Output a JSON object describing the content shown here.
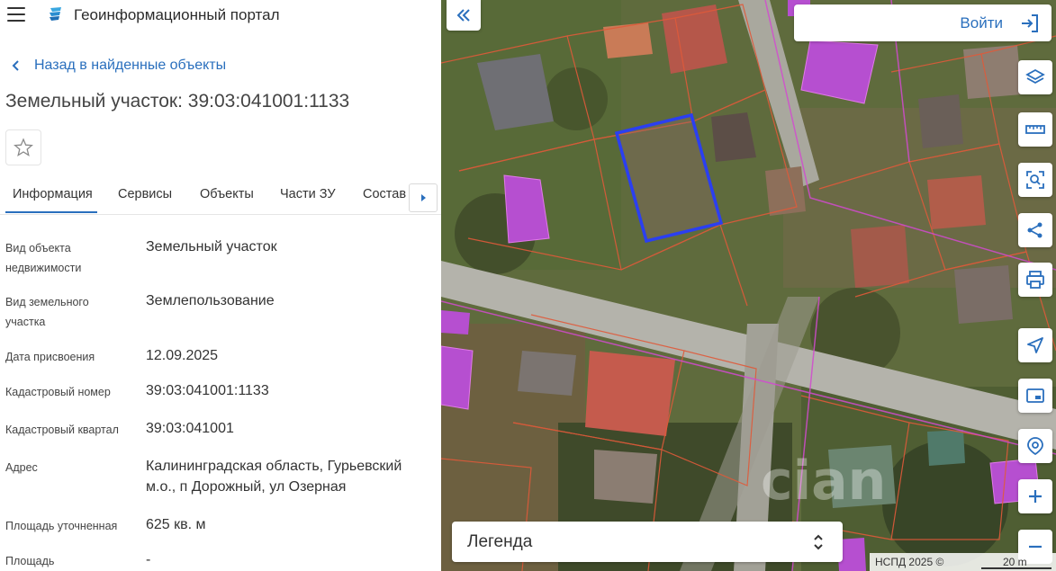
{
  "app": {
    "title": "Геоинформационный портал"
  },
  "nav": {
    "back_label": "Назад в найденные объекты"
  },
  "object": {
    "title": "Земельный участок: 39:03:041001:1133"
  },
  "tabs": [
    {
      "label": "Информация",
      "active": true
    },
    {
      "label": "Сервисы",
      "active": false
    },
    {
      "label": "Объекты",
      "active": false
    },
    {
      "label": "Части ЗУ",
      "active": false
    },
    {
      "label": "Состав",
      "active": false
    }
  ],
  "info_rows": [
    {
      "label": "Вид объекта недвижимости",
      "value": "Земельный участок"
    },
    {
      "label": "Вид земельного участка",
      "value": "Землепользование"
    },
    {
      "label": "Дата присвоения",
      "value": "12.09.2025"
    },
    {
      "label": "Кадастровый номер",
      "value": "39:03:041001:1133"
    },
    {
      "label": "Кадастровый квартал",
      "value": "39:03:041001"
    },
    {
      "label": "Адрес",
      "value": "Калининградская область, Гурьевский м.о., п Дорожный, ул Озерная"
    },
    {
      "label": "Площадь уточненная",
      "value": "625 кв. м"
    },
    {
      "label": "Площадь",
      "value": "-"
    }
  ],
  "map": {
    "login_label": "Войти",
    "legend_label": "Легенда",
    "attribution": "НСПД 2025 ©",
    "scale_label": "20 m",
    "watermark": "cian"
  },
  "toolbar": [
    {
      "name": "layers-icon"
    },
    {
      "name": "ruler-icon"
    },
    {
      "name": "search-area-icon"
    },
    {
      "name": "share-icon"
    },
    {
      "name": "print-icon"
    },
    {
      "name": "navigate-icon"
    },
    {
      "name": "minimap-icon"
    },
    {
      "name": "locate-icon"
    },
    {
      "name": "zoom-in-icon"
    },
    {
      "name": "zoom-out-icon"
    }
  ],
  "colors": {
    "accent": "#2a6fbd",
    "selected_parcel": "#2b3ff0",
    "parcel_border": "#e05a3a",
    "building_fill": "#b64fd0"
  }
}
